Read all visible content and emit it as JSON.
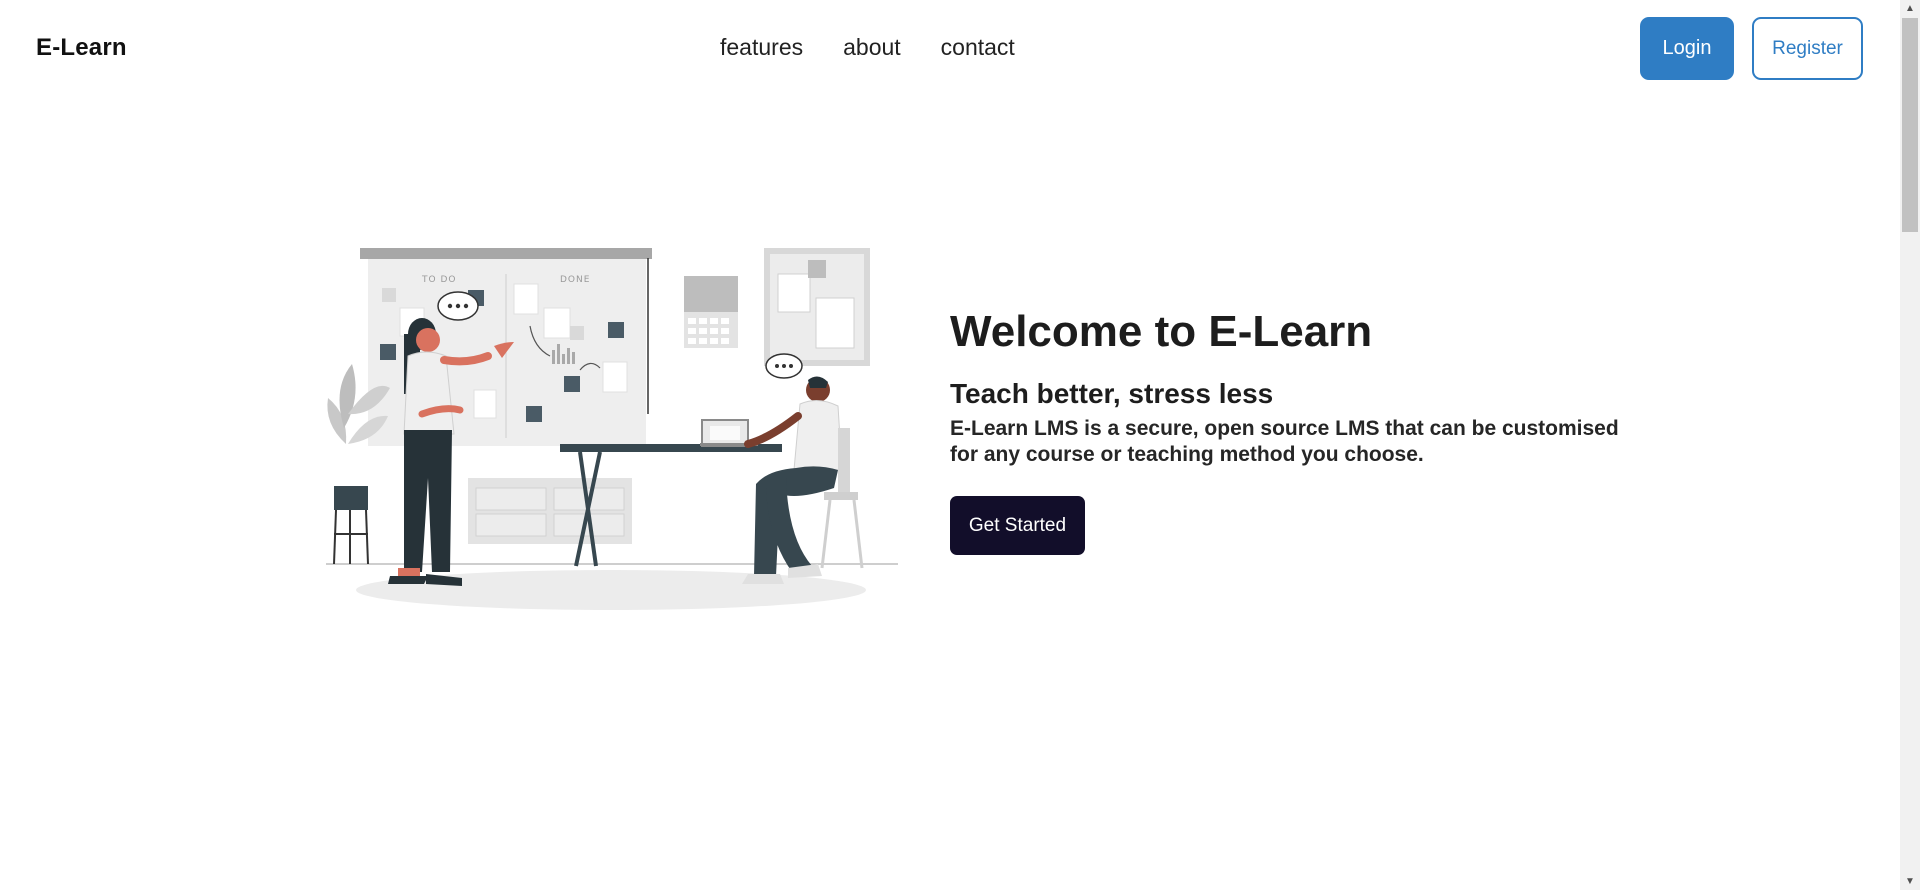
{
  "header": {
    "brand": "E-Learn",
    "nav": [
      "features",
      "about",
      "contact"
    ],
    "login_label": "Login",
    "register_label": "Register"
  },
  "hero": {
    "title": "Welcome to E-Learn",
    "subtitle": "Teach better, stress less",
    "description_line1": "E-Learn LMS is a secure, open source LMS that can be customised",
    "description_line2": "for any course or teaching method you choose.",
    "cta_label": "Get Started",
    "illustration": {
      "board_columns": [
        "TO DO",
        "DONE"
      ]
    }
  },
  "colors": {
    "primary": "#2f7dc4",
    "cta": "#120e2a",
    "accent_skin": "#d9725f",
    "dark_teal": "#37474f"
  }
}
